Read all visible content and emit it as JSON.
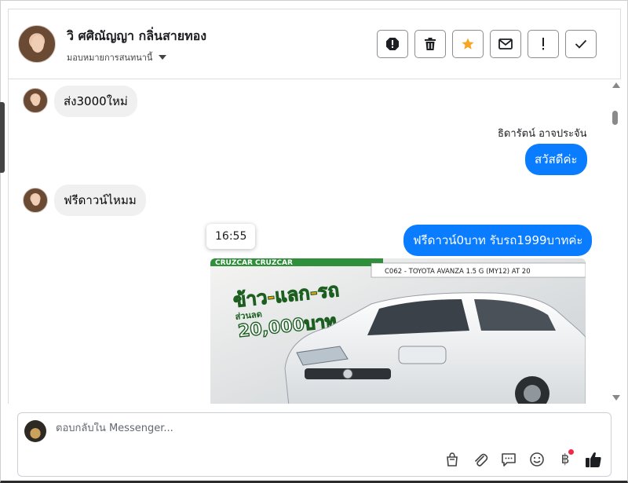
{
  "header": {
    "contact_name": "วิ ศศิณัญญา กลิ่นสายทอง",
    "assign_label": "มอบหมายการสนทนานี้",
    "actions": [
      {
        "name": "spam-icon",
        "label": "spam"
      },
      {
        "name": "trash-icon",
        "label": "delete"
      },
      {
        "name": "star-icon",
        "label": "star"
      },
      {
        "name": "mail-icon",
        "label": "mark unread"
      },
      {
        "name": "exclamation-icon",
        "label": "follow up"
      },
      {
        "name": "check-icon",
        "label": "done"
      }
    ]
  },
  "messages": [
    {
      "direction": "in",
      "text": "ส่ง3000ใหม่"
    },
    {
      "direction": "out",
      "sender": "ธิดารัตน์ อาจประจัน",
      "text": "สวัสดีค่ะ"
    },
    {
      "direction": "in",
      "text": "ฟรีดาวน์ไหมม"
    },
    {
      "direction": "out",
      "text": "ฟรีดาวน์0บาท รับรถ1999บาทค่ะ"
    }
  ],
  "tooltip_time": "16:55",
  "attachment": {
    "headline_1": "ข้าว-แลก-รถ",
    "discount_label": "ส่วนลด",
    "discount_amount": "20,000บาท",
    "strip_text": "C062 - TOYOTA AVANZA 1.5 G (MY12) AT 20",
    "top_strip": "CRUZCAR CRUZCAR"
  },
  "composer": {
    "placeholder": "ตอบกลับใน Messenger..."
  },
  "colors": {
    "outgoing_bubble": "#0a7cff",
    "incoming_bubble": "#f0f0f0",
    "star": "#f5a623",
    "notification_dot": "#f02849"
  }
}
